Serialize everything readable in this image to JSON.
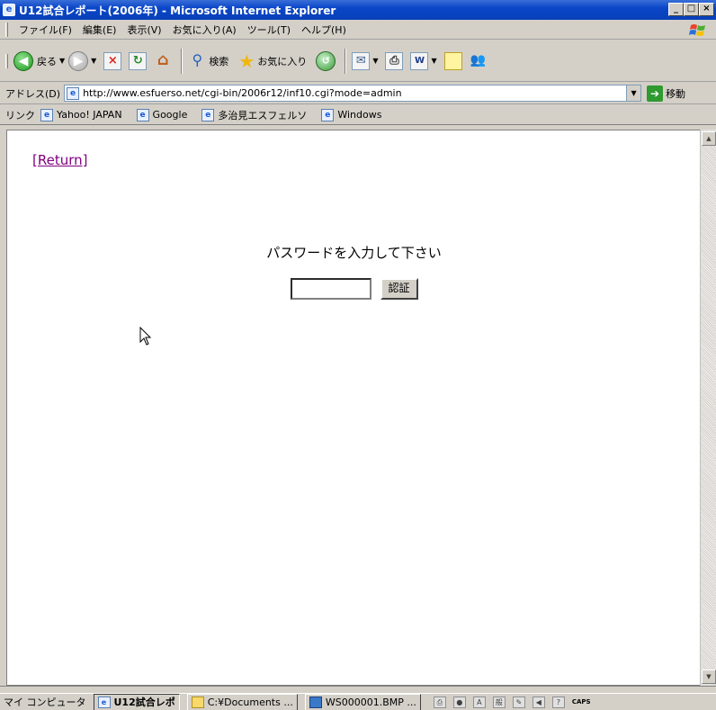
{
  "window": {
    "title": "U12試合レポート(2006年) - Microsoft Internet Explorer",
    "controls": {
      "minimize": "_",
      "maximize": "□",
      "close": "×"
    }
  },
  "menu": [
    "ファイル(F)",
    "編集(E)",
    "表示(V)",
    "お気に入り(A)",
    "ツール(T)",
    "ヘルプ(H)"
  ],
  "toolbar": {
    "back_label": "戻る",
    "search_label": "検索",
    "favorites_label": "お気に入り"
  },
  "address": {
    "label": "アドレス(D)",
    "url": "http://www.esfuerso.net/cgi-bin/2006r12/inf10.cgi?mode=admin",
    "go_label": "移動"
  },
  "links": {
    "label": "リンク",
    "items": [
      "Yahoo! JAPAN",
      "Google",
      "多治見エスフェルソ",
      "Windows"
    ]
  },
  "page": {
    "return_link": "[Return]",
    "prompt": "パスワードを入力して下さい",
    "password_value": "",
    "auth_button": "認証"
  },
  "taskbar": {
    "label": "マイ コンピュータ",
    "tasks": [
      "U12試合レポ",
      "C:¥Documents ...",
      "WS000001.BMP ..."
    ],
    "tray_text": "CAPS"
  },
  "colors": {
    "titlebar": "#0a46c8",
    "visited_link": "#800080",
    "chrome": "#d4d0c8"
  }
}
